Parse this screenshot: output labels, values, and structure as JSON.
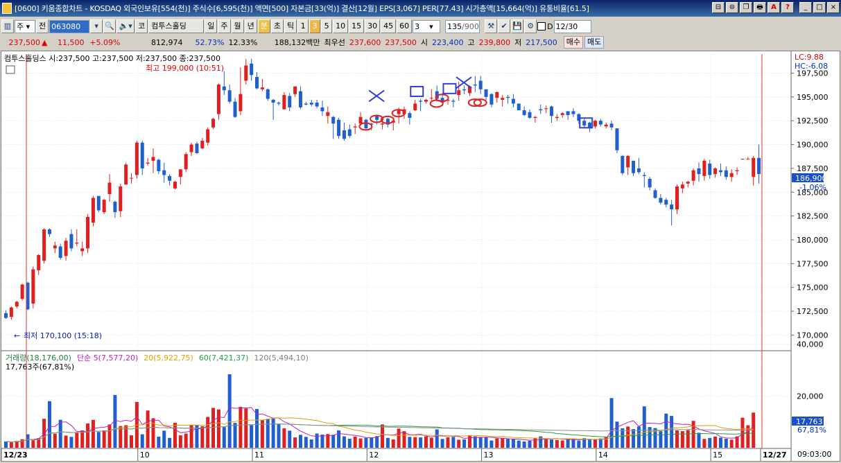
{
  "window": {
    "title": "[0600] 키움종합차트 - KOSDAQ 외국인보유[554(천)] 주식수[6,595(천)] 액면[500] 자본금[33(억)] 결산[12월] EPS[3,067] PER[77.43] 시가총액[15,664(억)] 유통비율[61.5]",
    "buttons": [
      "⊟",
      "⊜",
      "❐",
      "🖶",
      "A",
      "?",
      "_",
      "□",
      "×"
    ]
  },
  "toolbar": {
    "period_select": "주",
    "mode_button": "전",
    "code_input": "063080",
    "stock_name": "컴투스홀딩",
    "ko_label": "코",
    "periods": [
      "일",
      "주",
      "월",
      "년",
      "분",
      "초",
      "틱"
    ],
    "minutes": [
      "1",
      "3",
      "5",
      "10",
      "15",
      "30",
      "45",
      "60"
    ],
    "custom_value": "3",
    "bar_count": "135",
    "bar_total": "/900",
    "chk_label": "D",
    "date_value": "12/30"
  },
  "quote": {
    "price": "237,500",
    "arrow": "▲",
    "change": "11,500",
    "pct": "+5.09%",
    "volume": "812,974",
    "pct2": "52.73%",
    "pct3": "12.33%",
    "amount": "188,132백만",
    "prio_label": "최우선",
    "ask": "237,600",
    "bid": "237,500",
    "open_label": "시",
    "open": "223,400",
    "high_label": "고",
    "high": "239,800",
    "low_label": "저",
    "low": "217,500",
    "buy": "매수",
    "sell": "매도"
  },
  "price_pane": {
    "legend": "컴투스홀딩스 시:237,500 고:237,500 저:237,500 종:237,500",
    "high_note": "최고 199,000 (10:51)",
    "low_note": "최저 170,100 (15:18)",
    "lc": "LC:9.88",
    "hc": "HC:-6.08",
    "current": "186,900",
    "current_pct": "-1.06%",
    "yticks": [
      "197,500",
      "195,000",
      "192,500",
      "190,000",
      "187,500",
      "185,000",
      "182,500",
      "180,000",
      "177,500",
      "175,000",
      "172,500",
      "170,000"
    ]
  },
  "volume_pane": {
    "legend": [
      "거래량(18,176,00)",
      "단순 5(7,577,20)",
      "20(5,922,75)",
      "60(7,421,37)",
      "120(5,494,10)"
    ],
    "sub": "17,763주(67,81%)",
    "yticks": [
      "40,000",
      "20,000"
    ],
    "current": "17,763",
    "current_pct": "67,81%"
  },
  "xaxis": {
    "labels": [
      "12/23",
      "10",
      "11",
      "12",
      "13",
      "14",
      "15",
      "12/27"
    ],
    "time": "09:03:00"
  },
  "chart_data": {
    "type": "candlestick",
    "title": "컴투스홀딩스",
    "ylim": [
      168500,
      199500
    ],
    "candles": [
      [
        172300,
        172600,
        171700,
        171800
      ],
      [
        171900,
        173000,
        171600,
        172900
      ],
      [
        173000,
        173600,
        172800,
        173500
      ],
      [
        173800,
        175400,
        173600,
        175300
      ],
      [
        175500,
        175600,
        172600,
        172700
      ],
      [
        173300,
        177200,
        172800,
        176900
      ],
      [
        176800,
        178500,
        176300,
        178400
      ],
      [
        177800,
        181200,
        177500,
        181100
      ],
      [
        181100,
        181200,
        180300,
        180600
      ],
      [
        179100,
        179800,
        178600,
        179400
      ],
      [
        179300,
        179600,
        177900,
        178100
      ],
      [
        178300,
        180200,
        177800,
        179900
      ],
      [
        180600,
        181100,
        178800,
        179100
      ],
      [
        179600,
        181100,
        179300,
        179700
      ],
      [
        178800,
        179800,
        178300,
        179100
      ],
      [
        179100,
        182700,
        178600,
        182400
      ],
      [
        181800,
        184600,
        181400,
        184400
      ],
      [
        184600,
        184600,
        182900,
        183100
      ],
      [
        182900,
        184300,
        182700,
        184200
      ],
      [
        184800,
        186900,
        184000,
        186000
      ],
      [
        184000,
        184100,
        182300,
        182900
      ],
      [
        183000,
        185900,
        182400,
        185600
      ],
      [
        185800,
        188100,
        185800,
        187900
      ],
      [
        186500,
        187000,
        185900,
        186500
      ],
      [
        186800,
        190400,
        186400,
        190200
      ],
      [
        190200,
        190400,
        186800,
        187500
      ],
      [
        188000,
        188600,
        187800,
        188100
      ],
      [
        188300,
        189600,
        187000,
        188700
      ],
      [
        188400,
        188500,
        186900,
        187200
      ],
      [
        187300,
        188100,
        186000,
        186800
      ],
      [
        186700,
        186900,
        185700,
        186200
      ],
      [
        185400,
        186200,
        185300,
        186100
      ],
      [
        186600,
        187400,
        185800,
        187400
      ],
      [
        187400,
        189200,
        187100,
        189000
      ],
      [
        189200,
        190200,
        188800,
        190000
      ],
      [
        190100,
        190300,
        189000,
        189100
      ],
      [
        189600,
        190700,
        189500,
        190400
      ],
      [
        190200,
        191800,
        189900,
        191600
      ],
      [
        191800,
        192800,
        191600,
        192700
      ],
      [
        193200,
        196400,
        192600,
        196300
      ],
      [
        196100,
        197700,
        195200,
        195700
      ],
      [
        195700,
        196300,
        194300,
        194500
      ],
      [
        194500,
        194900,
        192800,
        192900
      ],
      [
        193500,
        198100,
        193100,
        195300
      ],
      [
        196700,
        199000,
        196300,
        198300
      ],
      [
        198500,
        199000,
        196700,
        197300
      ],
      [
        197100,
        197600,
        195800,
        195900
      ],
      [
        195800,
        196900,
        195600,
        196000
      ],
      [
        195800,
        195900,
        194600,
        194800
      ],
      [
        194700,
        194800,
        192600,
        194400
      ],
      [
        194400,
        194500,
        194100,
        194300
      ],
      [
        193700,
        195500,
        193700,
        195200
      ],
      [
        195100,
        195400,
        193500,
        193900
      ],
      [
        195300,
        196100,
        195000,
        196100
      ],
      [
        195600,
        196100,
        193700,
        193900
      ],
      [
        194300,
        194500,
        194100,
        194200
      ],
      [
        194400,
        194700,
        194000,
        194200
      ],
      [
        194400,
        194700,
        193800,
        194000
      ],
      [
        193900,
        194600,
        193000,
        193500
      ],
      [
        193000,
        194000,
        192200,
        193400
      ],
      [
        192900,
        193000,
        190600,
        192200
      ],
      [
        192600,
        192800,
        190600,
        190900
      ],
      [
        191500,
        192300,
        190400,
        190600
      ],
      [
        191600,
        192100,
        190700,
        190900
      ],
      [
        191800,
        192200,
        191100,
        191900
      ],
      [
        192200,
        193400,
        192000,
        192900
      ],
      [
        192600,
        192700,
        191600,
        191700
      ],
      [
        192200,
        192300,
        191500,
        192100
      ],
      [
        193000,
        193100,
        192100,
        192600
      ],
      [
        192100,
        192500,
        191600,
        192200
      ],
      [
        192700,
        192800,
        191800,
        192100
      ],
      [
        192300,
        192800,
        191500,
        192500
      ],
      [
        193200,
        193900,
        192200,
        193700
      ],
      [
        193200,
        194000,
        192700,
        193700
      ],
      [
        193300,
        193500,
        192100,
        192800
      ],
      [
        193600,
        194700,
        193500,
        194300
      ],
      [
        194600,
        194800,
        193500,
        194500
      ],
      [
        194500,
        194800,
        194300,
        194700
      ],
      [
        194900,
        195800,
        194500,
        194900
      ],
      [
        195600,
        196200,
        194500,
        194800
      ],
      [
        194900,
        195400,
        194300,
        194400
      ],
      [
        194600,
        194900,
        194200,
        194700
      ],
      [
        194600,
        194800,
        193900,
        194500
      ],
      [
        195200,
        196600,
        194600,
        195700
      ],
      [
        195800,
        196200,
        195300,
        195700
      ],
      [
        195400,
        196200,
        195100,
        196100
      ],
      [
        196300,
        197200,
        195500,
        196200
      ],
      [
        196700,
        197200,
        195300,
        195800
      ],
      [
        195800,
        195800,
        194700,
        195000
      ],
      [
        195300,
        195400,
        193900,
        194200
      ],
      [
        194900,
        195600,
        194400,
        195500
      ],
      [
        194700,
        195200,
        194000,
        194900
      ],
      [
        195000,
        195200,
        194300,
        194900
      ],
      [
        194800,
        195300,
        193900,
        194300
      ],
      [
        194300,
        194300,
        193600,
        193600
      ],
      [
        193600,
        194000,
        193000,
        193100
      ],
      [
        193400,
        193700,
        192700,
        192800
      ],
      [
        192800,
        193000,
        192300,
        192900
      ],
      [
        193700,
        194200,
        193200,
        193600
      ],
      [
        193800,
        194100,
        193300,
        193800
      ],
      [
        194000,
        194100,
        192300,
        193000
      ],
      [
        192800,
        193200,
        192500,
        192900
      ],
      [
        193100,
        193400,
        192800,
        193300
      ],
      [
        193500,
        193500,
        192600,
        193100
      ],
      [
        193500,
        193800,
        192900,
        193200
      ],
      [
        193200,
        193300,
        192200,
        192500
      ],
      [
        192500,
        192800,
        191700,
        192000
      ],
      [
        192300,
        192400,
        191300,
        191800
      ],
      [
        191900,
        192600,
        191700,
        192500
      ],
      [
        192500,
        192700,
        191900,
        192100
      ],
      [
        191900,
        192300,
        191700,
        192100
      ],
      [
        192200,
        192500,
        191500,
        191800
      ],
      [
        191700,
        191700,
        189100,
        189400
      ],
      [
        188800,
        188900,
        186800,
        187000
      ],
      [
        187600,
        188900,
        186800,
        188800
      ],
      [
        188300,
        188300,
        186700,
        187000
      ],
      [
        187500,
        188600,
        186900,
        187100
      ],
      [
        186800,
        187100,
        185500,
        186700
      ],
      [
        186400,
        186600,
        185200,
        185500
      ],
      [
        185200,
        185400,
        184300,
        184400
      ],
      [
        184400,
        184800,
        183700,
        183900
      ],
      [
        184200,
        184400,
        183400,
        183700
      ],
      [
        183700,
        184200,
        181500,
        183200
      ],
      [
        183200,
        185800,
        182700,
        185600
      ],
      [
        185400,
        186100,
        184900,
        185800
      ],
      [
        185900,
        186200,
        185500,
        186100
      ],
      [
        186200,
        187500,
        185700,
        187300
      ],
      [
        187500,
        188100,
        186100,
        186900
      ],
      [
        186700,
        188500,
        186200,
        188300
      ],
      [
        188000,
        188400,
        186400,
        186800
      ],
      [
        186900,
        187600,
        186500,
        187500
      ],
      [
        187300,
        188000,
        186700,
        187100
      ],
      [
        187300,
        187700,
        186300,
        186600
      ],
      [
        186600,
        187400,
        186100,
        187000
      ],
      [
        187200,
        187600,
        186800,
        187300
      ],
      [
        188500,
        188500,
        188400,
        188500
      ],
      [
        188500,
        188700,
        188400,
        188500
      ],
      [
        186600,
        188800,
        185700,
        188600
      ],
      [
        188600,
        190000,
        185900,
        186900
      ]
    ],
    "volume": [
      2400,
      2100,
      2600,
      3300,
      5200,
      2900,
      3700,
      11200,
      18000,
      5400,
      10800,
      4700,
      4200,
      5800,
      6700,
      9400,
      10800,
      6100,
      6700,
      9000,
      20400,
      8400,
      8700,
      4800,
      17700,
      5200,
      14400,
      11400,
      4300,
      6600,
      3800,
      9600,
      4800,
      5500,
      8700,
      8800,
      8300,
      11900,
      15400,
      14800,
      8000,
      28400,
      9600,
      15800,
      15200,
      8700,
      15000,
      10800,
      11200,
      11500,
      9100,
      7500,
      6600,
      4000,
      5000,
      4200,
      3200,
      5500,
      5100,
      5300,
      5000,
      6700,
      4400,
      3500,
      4300,
      3600,
      3800,
      4000,
      4500,
      9000,
      3800,
      3200,
      7400,
      6400,
      4200,
      4100,
      4000,
      4400,
      3800,
      7100,
      3400,
      4000,
      4200,
      3100,
      3200,
      4800,
      4400,
      4200,
      4000,
      2800,
      3600,
      3700,
      3400,
      3300,
      2800,
      2400,
      2700,
      3600,
      4400,
      3500,
      3200,
      3000,
      2800,
      3600,
      3300,
      2800,
      3700,
      3100,
      3100,
      3600,
      4100,
      19200,
      10100,
      7500,
      8200,
      7200,
      8200,
      16000,
      8000,
      7600,
      6400,
      13200,
      12300,
      6700,
      6400,
      6800,
      10400,
      5800,
      3400,
      3800,
      4300,
      3900,
      3500,
      3100,
      4400,
      11600,
      8700,
      13600
    ],
    "ma_lines": [
      {
        "name": "단순 5",
        "color": "#c020c0"
      },
      {
        "name": "20",
        "color": "#e0a000"
      },
      {
        "name": "60",
        "color": "#20a040"
      },
      {
        "name": "120",
        "color": "#909090"
      }
    ]
  }
}
